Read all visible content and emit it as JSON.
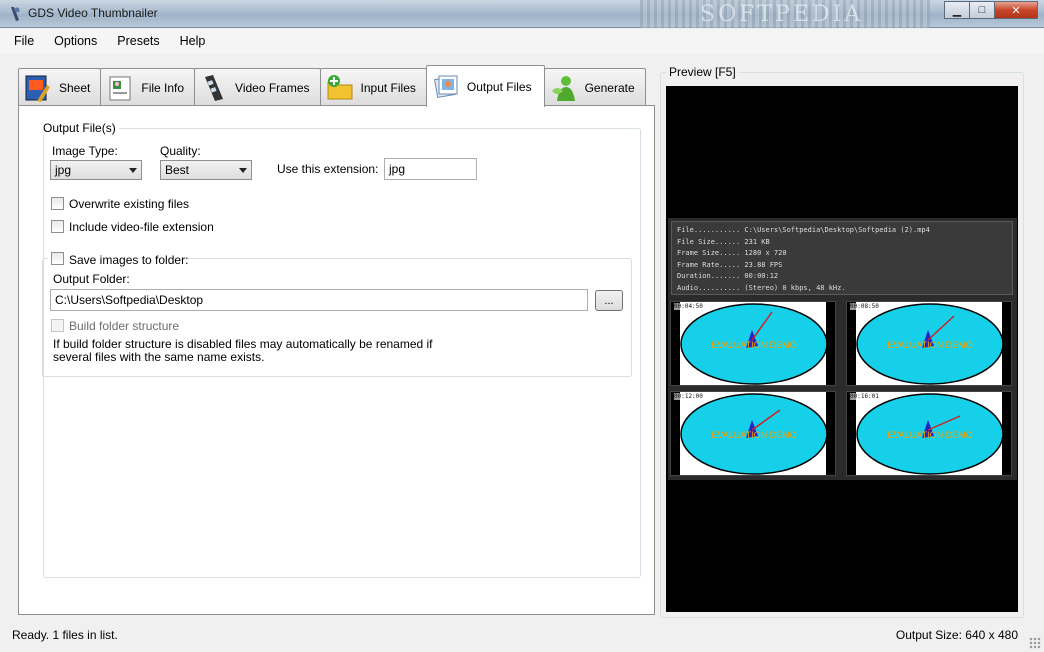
{
  "window": {
    "title": "GDS Video Thumbnailer",
    "watermark": "SOFTPEDIA"
  },
  "menu": [
    "File",
    "Options",
    "Presets",
    "Help"
  ],
  "tabs": [
    {
      "label": "Sheet",
      "icon": "sheet-icon"
    },
    {
      "label": "File Info",
      "icon": "file-info-icon"
    },
    {
      "label": "Video Frames",
      "icon": "film-icon"
    },
    {
      "label": "Input Files",
      "icon": "folder-add-icon"
    },
    {
      "label": "Output Files",
      "icon": "output-images-icon",
      "active": true
    },
    {
      "label": "Generate",
      "icon": "generate-icon"
    }
  ],
  "output": {
    "group_label": "Output File(s)",
    "image_type_label": "Image Type:",
    "image_type_value": "jpg",
    "quality_label": "Quality:",
    "quality_value": "Best",
    "extension_label": "Use this extension:",
    "extension_value": "jpg",
    "overwrite_label": "Overwrite existing files",
    "include_ext_label": "Include video-file extension",
    "save_folder_label": "Save images to folder:",
    "output_folder_label": "Output Folder:",
    "output_folder_value": "C:\\Users\\Softpedia\\Desktop",
    "browse_label": "...",
    "build_structure_label": "Build folder structure",
    "note_line1": "If build folder structure is disabled files may automatically be renamed if",
    "note_line2": "several files with the same name exists."
  },
  "preview": {
    "label": "Preview  [F5]",
    "info": [
      "File........... C:\\Users\\Softpedia\\Desktop\\Softpedia (2).mp4",
      "File Size...... 231 KB",
      "Frame Size..... 1280 x 720",
      "Frame Rate..... 23.88 FPS",
      "Duration....... 00:00:12",
      "Audio.......... (Stereo) 0 kbps, 48 kHz."
    ],
    "thumbs": [
      {
        "time": "00:04:50",
        "text": "EVALUATION DEMO"
      },
      {
        "time": "00:08:50",
        "text": "EVALUATION DEMO"
      },
      {
        "time": "00:12:00",
        "text": "EVALUATION DEMO"
      },
      {
        "time": "00:16:01",
        "text": "EVALUATION DEMO"
      }
    ]
  },
  "status": {
    "left": "Ready. 1 files in list.",
    "right": "Output Size: 640 x 480"
  }
}
